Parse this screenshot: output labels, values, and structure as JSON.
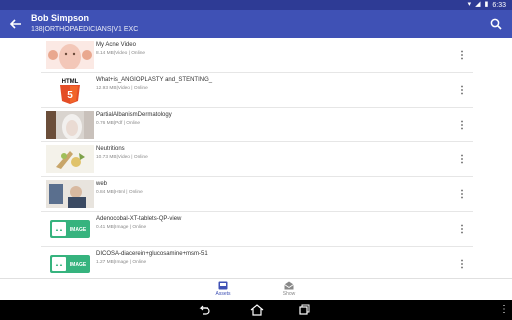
{
  "status_bar": {
    "time": "6:33",
    "icons": [
      "wifi-icon",
      "signal-icon",
      "battery-icon"
    ]
  },
  "header": {
    "title": "Bob Simpson",
    "subtitle": "138|ORTHOPAEDICIANS|V1 EXC",
    "back_icon": "arrow-back-icon",
    "search_icon": "search-icon",
    "color": "#3f51b5"
  },
  "assets": [
    {
      "title": "My Acne Video",
      "subtitle": "8.14 MB|Video | Online",
      "thumb": "face"
    },
    {
      "title": "What+is_ANGIOPLASTY and_STENTING_",
      "subtitle": "12.93 MB|Video | Online",
      "thumb": "html5"
    },
    {
      "title": "PartialAlbanismDermatology",
      "subtitle": "0.76 MB|Pdf | Online",
      "thumb": "portrait"
    },
    {
      "title": "Neutritions",
      "subtitle": "10.73 MB|Video | Online",
      "thumb": "food"
    },
    {
      "title": "web",
      "subtitle": "0.84 MB|Html | Online",
      "thumb": "web"
    },
    {
      "title": "Adenocobal-XT-tablets-QP-view",
      "subtitle": "0.41 MB|Image | Online",
      "thumb": "image"
    },
    {
      "title": "DICOSA-diacerein+glucosamine+msm-51",
      "subtitle": "1.27 MB|Image | Online",
      "thumb": "image"
    }
  ],
  "image_thumb_label": "IMAGE",
  "bottom_nav": [
    {
      "label": "Assets",
      "active": true
    },
    {
      "label": "Show",
      "active": false
    }
  ],
  "accent_color": "#3f51b5"
}
